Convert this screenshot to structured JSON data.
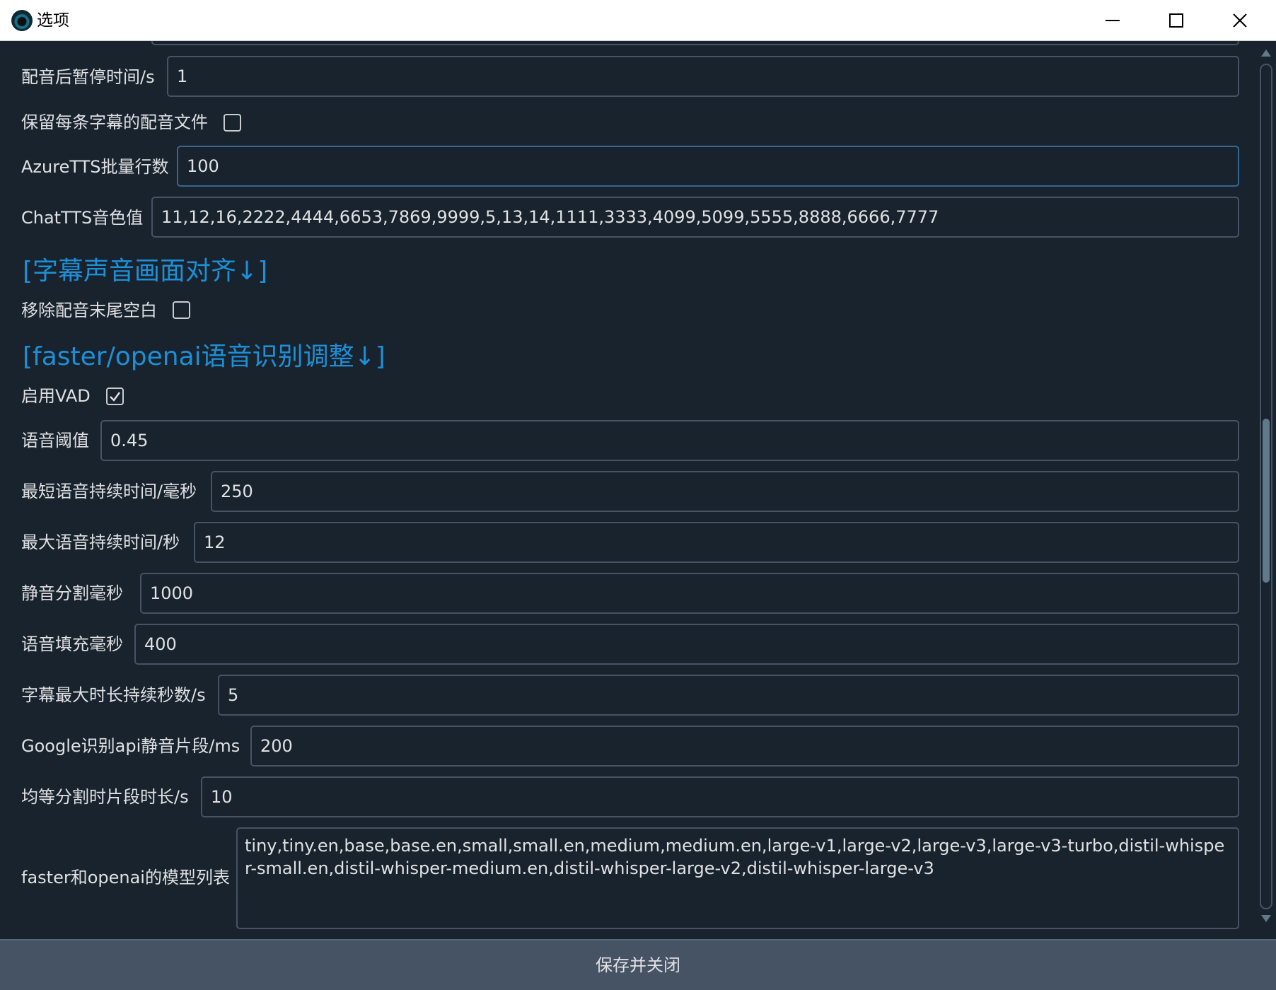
{
  "window": {
    "title": "选项"
  },
  "fields": {
    "pause_after_dub": {
      "label": "配音后暂停时间/s",
      "value": "1"
    },
    "keep_dub_files": {
      "label": "保留每条字幕的配音文件",
      "checked": false
    },
    "azure_batch": {
      "label": "AzureTTS批量行数",
      "value": "100"
    },
    "chattts_voice": {
      "label": "ChatTTS音色值",
      "value": "11,12,16,2222,4444,6653,7869,9999,5,13,14,1111,3333,4099,5099,5555,8888,6666,7777"
    },
    "remove_trailing": {
      "label": "移除配音末尾空白",
      "checked": false
    },
    "enable_vad": {
      "label": "启用VAD",
      "checked": true
    },
    "voice_threshold": {
      "label": "语音阈值",
      "value": "0.45"
    },
    "min_speech_ms": {
      "label": "最短语音持续时间/毫秒",
      "value": "250"
    },
    "max_speech_s": {
      "label": "最大语音持续时间/秒",
      "value": "12"
    },
    "silence_split_ms": {
      "label": "静音分割毫秒",
      "value": "1000"
    },
    "speech_pad_ms": {
      "label": "语音填充毫秒",
      "value": "400"
    },
    "subtitle_max_s": {
      "label": "字幕最大时长持续秒数/s",
      "value": "5"
    },
    "google_silence_ms": {
      "label": "Google识别api静音片段/ms",
      "value": "200"
    },
    "equal_split_s": {
      "label": "均等分割时片段时长/s",
      "value": "10"
    },
    "model_list": {
      "label": "faster和openai的模型列表",
      "value": "tiny,tiny.en,base,base.en,small,small.en,medium,medium.en,large-v1,large-v2,large-v3,large-v3-turbo,distil-whisper-small.en,distil-whisper-medium.en,distil-whisper-large-v2,distil-whisper-large-v3"
    }
  },
  "sections": {
    "align": "[字幕声音画面对齐↓]",
    "recognition": "[faster/openai语音识别调整↓]"
  },
  "actions": {
    "save_label": "保存并关闭"
  },
  "colors": {
    "background": "#19232d",
    "section_heading": "#1e8fd6",
    "border": "#455364",
    "focus_border": "#346792"
  }
}
